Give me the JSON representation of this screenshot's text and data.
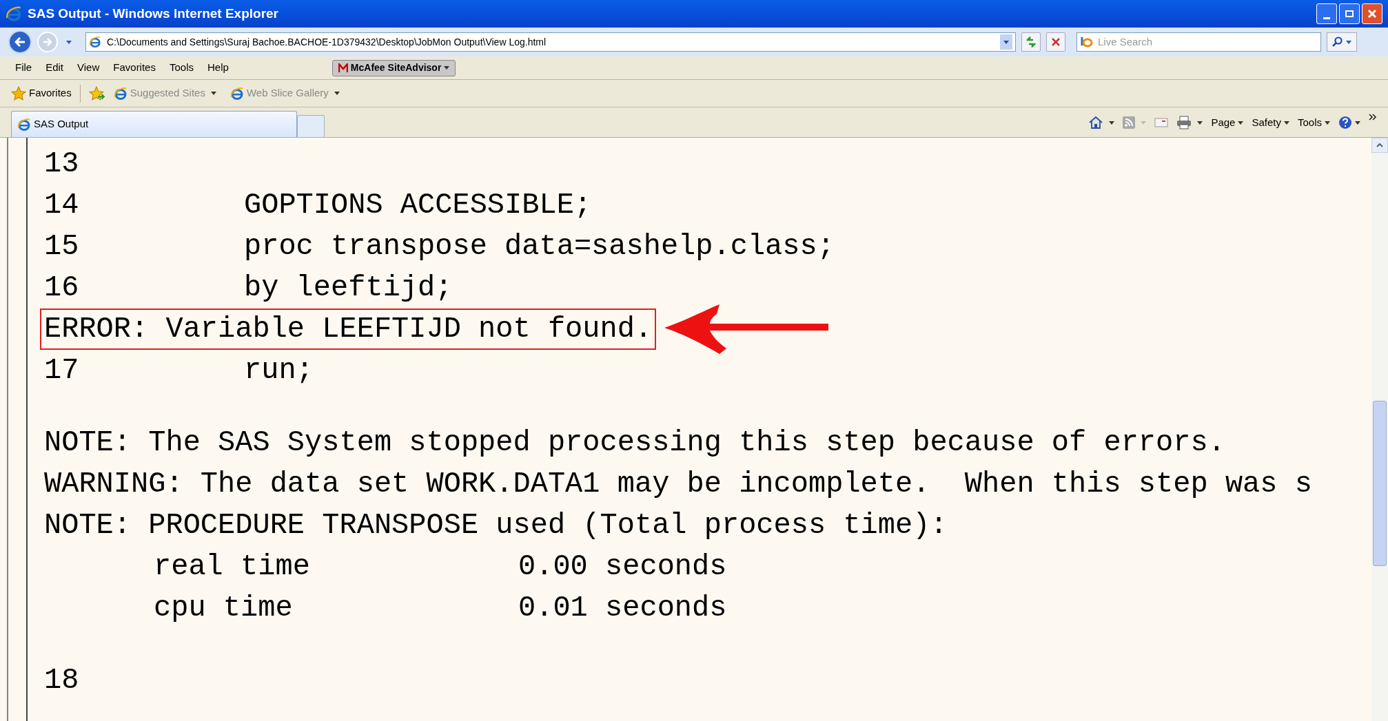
{
  "window": {
    "title": "SAS Output - Windows Internet Explorer"
  },
  "address_bar": {
    "value": "C:\\Documents and Settings\\Suraj Bachoe.BACHOE-1D379432\\Desktop\\JobMon Output\\View Log.html"
  },
  "search": {
    "placeholder": "Live Search"
  },
  "menu": [
    "File",
    "Edit",
    "View",
    "Favorites",
    "Tools",
    "Help"
  ],
  "addon": {
    "label": "McAfee SiteAdvisor"
  },
  "favorites_bar": {
    "label": "Favorites",
    "links": [
      "Suggested Sites",
      "Web Slice Gallery"
    ]
  },
  "tabs": [
    {
      "label": "SAS Output",
      "selected": true
    }
  ],
  "command_bar": [
    "Page",
    "Safety",
    "Tools"
  ],
  "log": [
    {
      "kind": "code",
      "number": "13"
    },
    {
      "kind": "code",
      "number": "14",
      "text": "GOPTIONS ACCESSIBLE;"
    },
    {
      "kind": "code",
      "number": "15",
      "text": "proc transpose data=sashelp.class;"
    },
    {
      "kind": "code",
      "number": "16",
      "text": "by leeftijd;"
    },
    {
      "kind": "error",
      "text": "ERROR: Variable LEEFTIJD not found."
    },
    {
      "kind": "code",
      "number": "17",
      "text": "run;"
    },
    {
      "kind": "blank"
    },
    {
      "kind": "message",
      "text": "NOTE: The SAS System stopped processing this step because of errors."
    },
    {
      "kind": "message",
      "text": "WARNING: The data set WORK.DATA1 may be incomplete.  When this step was s"
    },
    {
      "kind": "message",
      "text": "NOTE: PROCEDURE TRANSPOSE used (Total process time):"
    },
    {
      "kind": "detail",
      "label": "real time",
      "value": "0.00 seconds"
    },
    {
      "kind": "detail",
      "label": "cpu time",
      "value": "0.01 seconds"
    },
    {
      "kind": "blank"
    },
    {
      "kind": "code",
      "number": "18"
    }
  ]
}
